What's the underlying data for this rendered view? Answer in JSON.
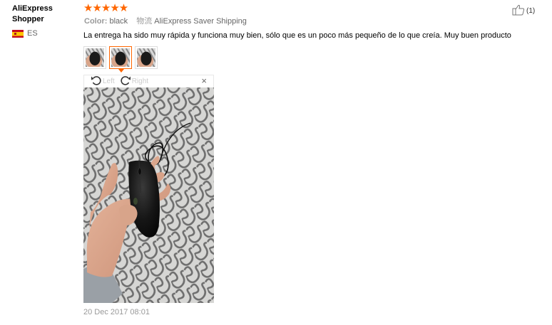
{
  "review": {
    "user_name": "AliExpress Shopper",
    "country_code": "ES",
    "stars": 5,
    "star_glyphs": "★★★★★",
    "color_label": "Color:",
    "color_value": "black",
    "shipping_label": "物流",
    "shipping_value": "AliExpress Saver Shipping",
    "text": "La entrega ha sido muy rápida y funciona muy bien, sólo que es un poco más pequeño de lo que creía. Muy buen producto",
    "helpful_count": "(1)",
    "date": "20 Dec 2017 08:01",
    "viewer": {
      "rotate_left": "Left",
      "rotate_right": "Right",
      "close": "×"
    },
    "thumbnails": [
      {
        "name": "photo-1",
        "active": false
      },
      {
        "name": "photo-2",
        "active": true
      },
      {
        "name": "photo-3",
        "active": false
      }
    ]
  },
  "colors": {
    "star": "#ff6600",
    "active_border": "#ff6600",
    "muted_text": "#999999"
  }
}
